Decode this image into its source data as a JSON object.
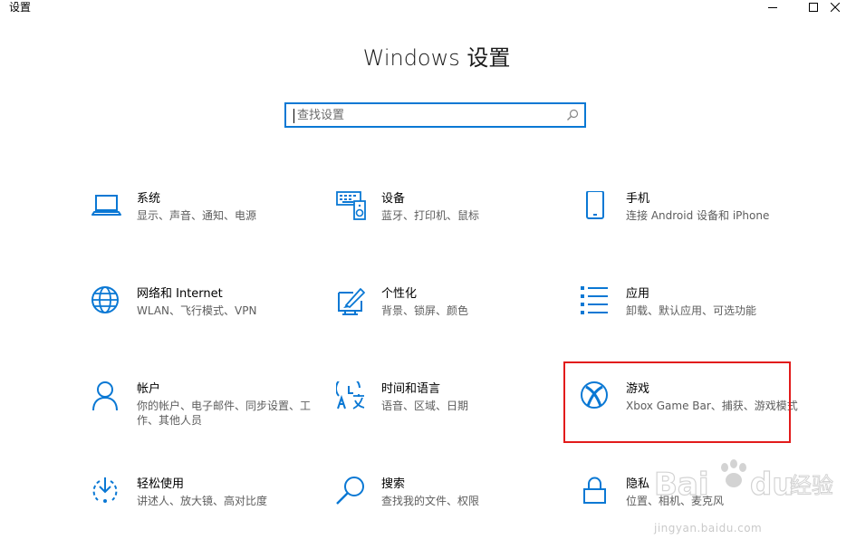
{
  "window": {
    "title": "设置",
    "controls": [
      "minimize-icon",
      "maximize-icon",
      "close-icon"
    ]
  },
  "heading": "Windows 设置",
  "search": {
    "placeholder": "查找设置",
    "value": "",
    "icon": "search-icon"
  },
  "tiles": [
    {
      "id": "system",
      "icon": "laptop-icon",
      "title": "系统",
      "desc": "显示、声音、通知、电源"
    },
    {
      "id": "devices",
      "icon": "keyboard-speaker-icon",
      "title": "设备",
      "desc": "蓝牙、打印机、鼠标"
    },
    {
      "id": "phone",
      "icon": "phone-icon",
      "title": "手机",
      "desc": "连接 Android 设备和 iPhone"
    },
    {
      "id": "network",
      "icon": "globe-icon",
      "title": "网络和 Internet",
      "desc": "WLAN、飞行模式、VPN"
    },
    {
      "id": "personalization",
      "icon": "paint-icon",
      "title": "个性化",
      "desc": "背景、锁屏、颜色"
    },
    {
      "id": "apps",
      "icon": "app-list-icon",
      "title": "应用",
      "desc": "卸载、默认应用、可选功能"
    },
    {
      "id": "accounts",
      "icon": "person-icon",
      "title": "帐户",
      "desc": "你的帐户、电子邮件、同步设置、工作、其他人员"
    },
    {
      "id": "time-language",
      "icon": "language-clock-icon",
      "title": "时间和语言",
      "desc": "语音、区域、日期"
    },
    {
      "id": "gaming",
      "icon": "xbox-icon",
      "title": "游戏",
      "desc": "Xbox Game Bar、捕获、游戏模式"
    },
    {
      "id": "ease-of-access",
      "icon": "ease-of-access-icon",
      "title": "轻松使用",
      "desc": "讲述人、放大镜、高对比度"
    },
    {
      "id": "search",
      "icon": "magnifier-icon",
      "title": "搜索",
      "desc": "查找我的文件、权限"
    },
    {
      "id": "privacy",
      "icon": "lock-icon",
      "title": "隐私",
      "desc": "位置、相机、麦克风"
    }
  ],
  "watermark": {
    "logo": "baidu-jingyan-logo",
    "text": "jingyan.baidu.com"
  },
  "colors": {
    "accent": "#0a78d4",
    "highlight": "#e21b1b"
  }
}
